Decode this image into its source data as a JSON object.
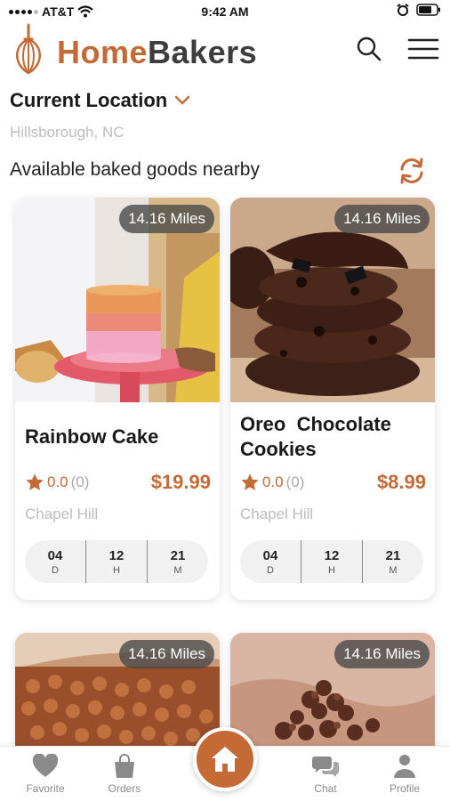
{
  "status_bar": {
    "carrier": "AT&T",
    "time": "9:42 AM"
  },
  "header": {
    "brand_home": "Home",
    "brand_bakers": "Bakers"
  },
  "location": {
    "title": "Current Location",
    "city": "Hillsborough, NC"
  },
  "section_title": "Available baked goods nearby",
  "colors": {
    "accent": "#c46a35",
    "text_dark": "#1a1a1a",
    "muted": "#bdbdbd"
  },
  "products": [
    {
      "distance": "14.16 Miles",
      "name": "Rainbow Cake",
      "rating": "0.0",
      "review_count": "(0)",
      "price": "$19.99",
      "city": "Chapel Hill",
      "timer": {
        "days": "04",
        "days_unit": "D",
        "hours": "12",
        "hours_unit": "H",
        "minutes": "21",
        "minutes_unit": "M"
      }
    },
    {
      "distance": "14.16 Miles",
      "name_line1": "Oreo  Chocolate",
      "name_line2": "Cookies",
      "rating": "0.0",
      "review_count": "(0)",
      "price": "$8.99",
      "city": "Chapel Hill",
      "timer": {
        "days": "04",
        "days_unit": "D",
        "hours": "12",
        "hours_unit": "H",
        "minutes": "21",
        "minutes_unit": "M"
      }
    },
    {
      "distance": "14.16 Miles"
    },
    {
      "distance": "14.16 Miles"
    }
  ],
  "bottom_nav": {
    "favorite": "Favorite",
    "orders": "Orders",
    "chat": "Chat",
    "profile": "Profile"
  },
  "icons": [
    "whisk-logo-icon",
    "search-icon",
    "menu-icon",
    "chevron-down-icon",
    "refresh-icon",
    "star-icon",
    "heart-icon",
    "bag-icon",
    "home-icon",
    "chat-icon",
    "person-icon",
    "wifi-icon",
    "alarm-icon",
    "battery-icon"
  ]
}
